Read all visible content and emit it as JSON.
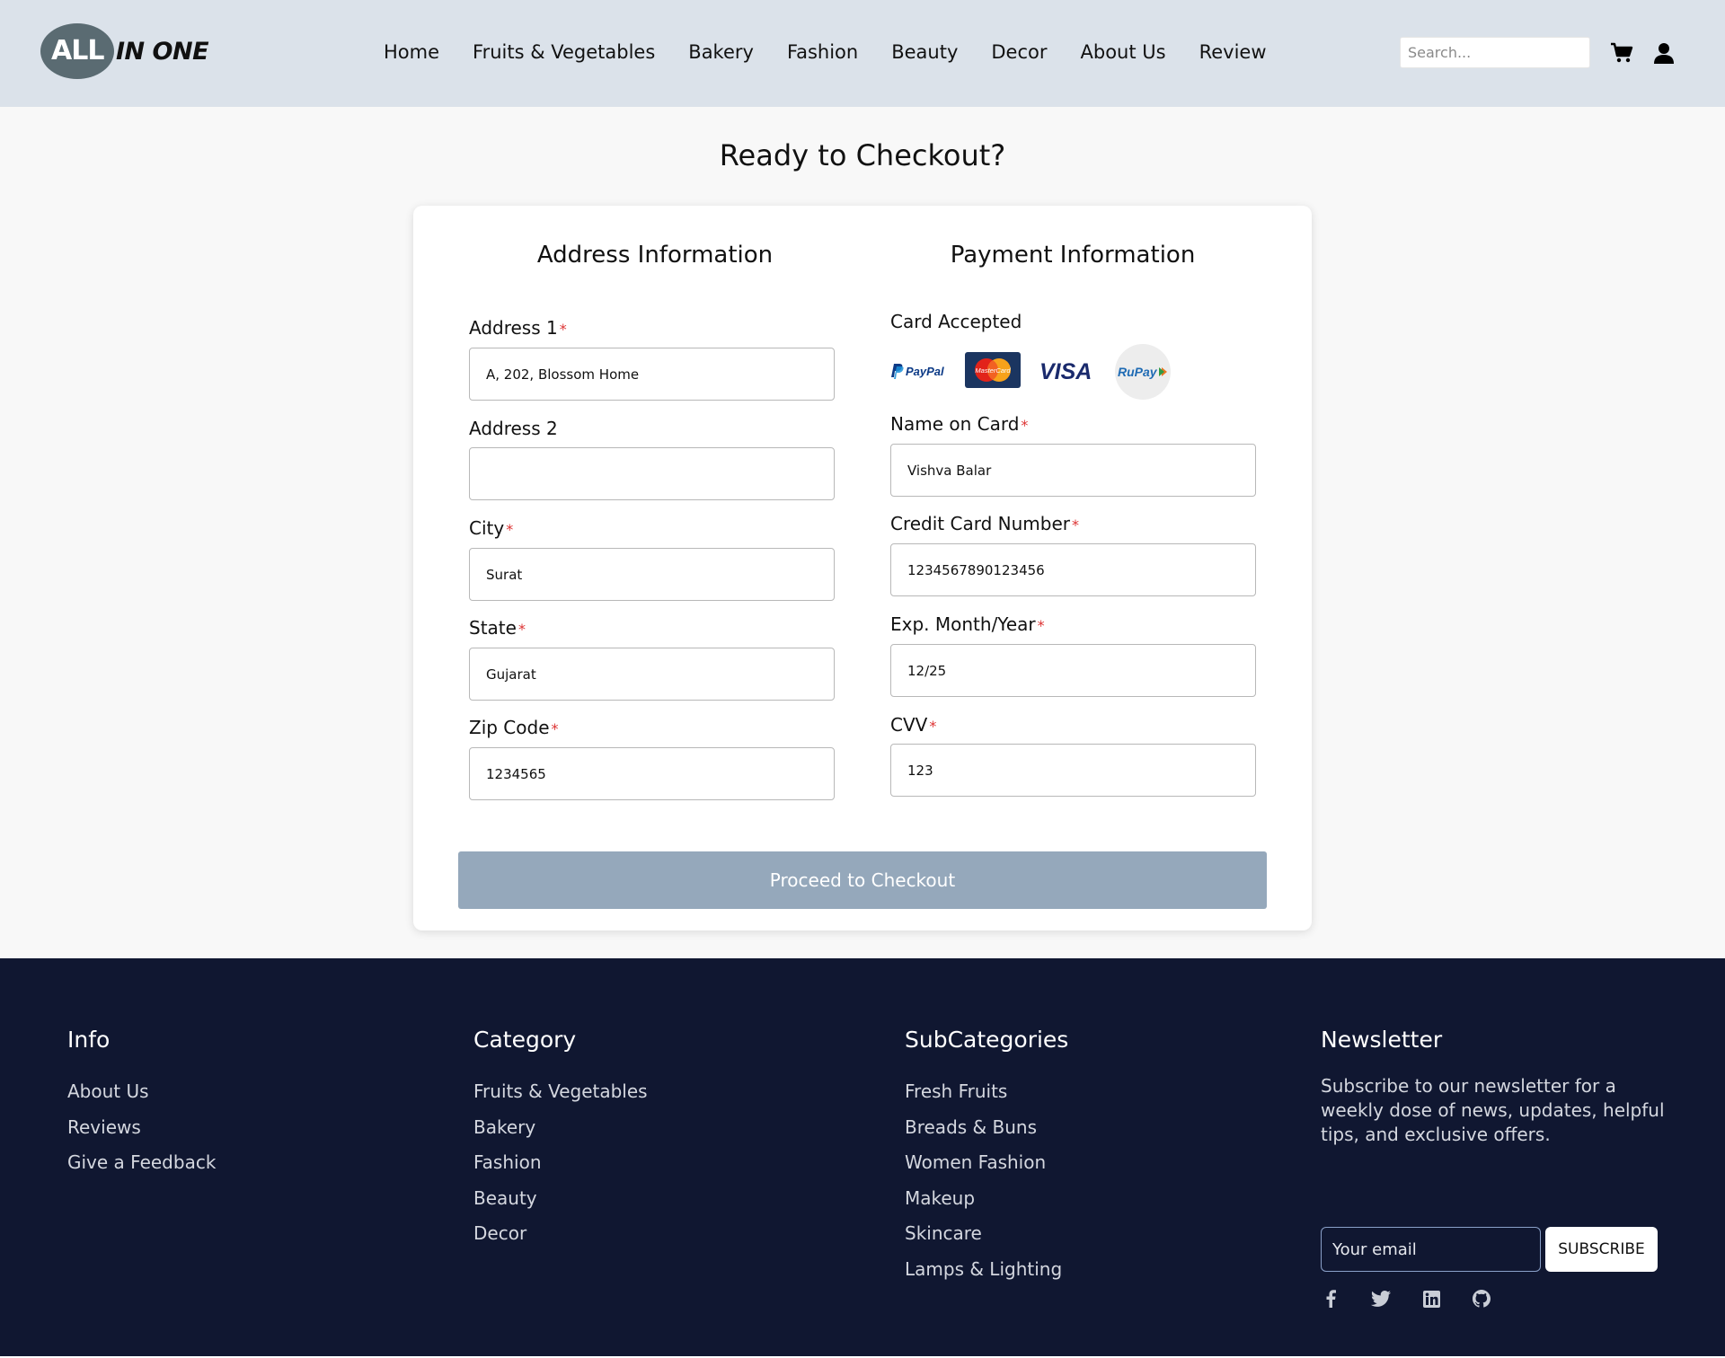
{
  "header": {
    "logo_all": "ALL",
    "logo_one": "IN ONE",
    "nav": [
      "Home",
      "Fruits & Vegetables",
      "Bakery",
      "Fashion",
      "Beauty",
      "Decor",
      "About Us",
      "Review"
    ],
    "search_placeholder": "Search..."
  },
  "main": {
    "title": "Ready to Checkout?",
    "address": {
      "title": "Address Information",
      "address1_label": "Address 1",
      "address1_value": "A, 202, Blossom Home",
      "address2_label": "Address 2",
      "address2_value": "",
      "city_label": "City",
      "city_value": "Surat",
      "state_label": "State",
      "state_value": "Gujarat",
      "zip_label": "Zip Code",
      "zip_value": "1234565"
    },
    "payment": {
      "title": "Payment Information",
      "cards_label": "Card Accepted",
      "cards": [
        "PayPal",
        "MasterCard",
        "VISA",
        "RuPay"
      ],
      "name_label": "Name on Card",
      "name_value": "Vishva Balar",
      "number_label": "Credit Card Number",
      "number_value": "1234567890123456",
      "exp_label": "Exp. Month/Year",
      "exp_value": "12/25",
      "cvv_label": "CVV",
      "cvv_value": "123"
    },
    "required_mark": "*",
    "checkout_button": "Proceed to Checkout"
  },
  "footer": {
    "info": {
      "title": "Info",
      "links": [
        "About Us",
        "Reviews",
        "Give a Feedback"
      ]
    },
    "category": {
      "title": "Category",
      "links": [
        "Fruits & Vegetables",
        "Bakery",
        "Fashion",
        "Beauty",
        "Decor"
      ]
    },
    "subcategories": {
      "title": "SubCategories",
      "links": [
        "Fresh Fruits",
        "Breads & Buns",
        "Women Fashion",
        "Makeup",
        "Skincare",
        "Lamps & Lighting"
      ]
    },
    "newsletter": {
      "title": "Newsletter",
      "text": "Subscribe to our newsletter for a weekly dose of news, updates, helpful tips, and exclusive offers.",
      "email_placeholder": "Your email",
      "subscribe_label": "SUBSCRIBE",
      "socials": [
        "facebook-icon",
        "twitter-icon",
        "linkedin-icon",
        "github-icon"
      ]
    }
  },
  "colors": {
    "header_bg": "#dbe2ea",
    "footer_bg": "#101731",
    "button_bg": "#95a8bb",
    "required": "#dd3333"
  }
}
